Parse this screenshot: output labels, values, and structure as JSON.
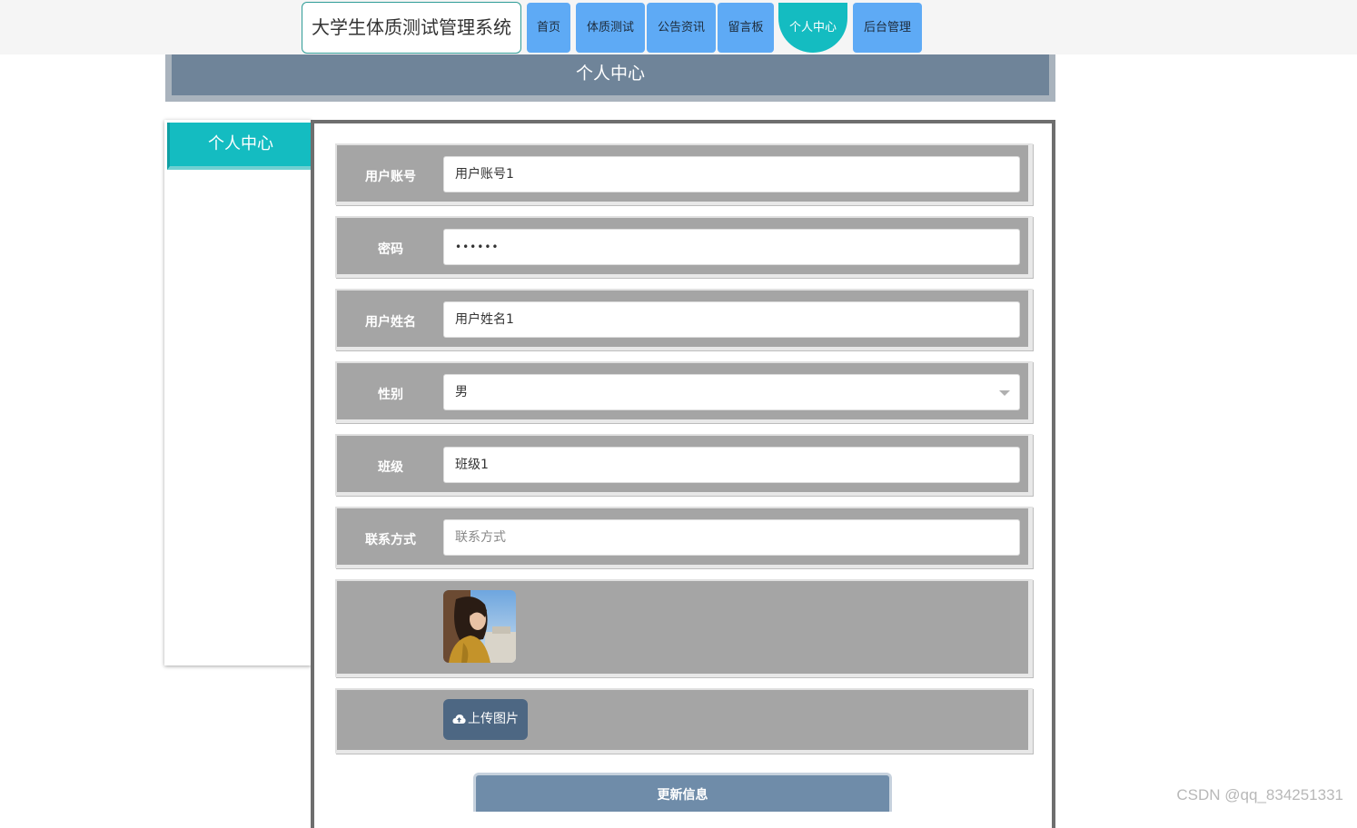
{
  "header": {
    "site_title": "大学生体质测试管理系统",
    "nav": [
      {
        "label": "首页"
      },
      {
        "label": "体质测试"
      },
      {
        "label": "公告资讯"
      },
      {
        "label": "留言板"
      },
      {
        "label": "个人中心",
        "active": true
      },
      {
        "label": "后台管理"
      }
    ]
  },
  "banner": {
    "title": "个人中心"
  },
  "sidebar": {
    "title": "个人中心"
  },
  "form": {
    "fields": [
      {
        "label": "用户账号",
        "value": "用户账号1"
      },
      {
        "label": "密码",
        "value": "••••••"
      },
      {
        "label": "用户姓名",
        "value": "用户姓名1"
      },
      {
        "label": "性别",
        "value": "男"
      },
      {
        "label": "班级",
        "value": "班级1"
      },
      {
        "label": "联系方式",
        "placeholder": "联系方式",
        "value": ""
      }
    ],
    "upload_label": "上传图片",
    "submit_label": "更新信息"
  },
  "watermark": "CSDN @qq_834251331",
  "colors": {
    "nav_button": "#5eaaf5",
    "nav_active": "#14bcc1",
    "banner": "#6f8499",
    "form_row": "#a5a5a5",
    "upload_button": "#4d6783",
    "submit_button": "#6f8ca9"
  },
  "icons": {
    "upload": "cloud-upload-icon",
    "select": "chevron-down-icon"
  }
}
